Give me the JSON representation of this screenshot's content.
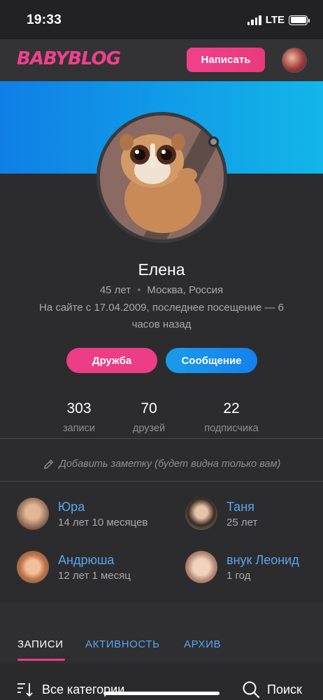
{
  "status_bar": {
    "time": "19:33",
    "network": "LTE"
  },
  "header": {
    "logo": "BABYBLOG",
    "write_button": "Написать"
  },
  "profile": {
    "name": "Елена",
    "age": "45 лет",
    "location": "Москва, Россия",
    "since": "На сайте с 17.04.2009, последнее посещение — 6 часов назад",
    "friend_button": "Дружба",
    "message_button": "Сообщение"
  },
  "stats": [
    {
      "value": "303",
      "label": "записи"
    },
    {
      "value": "70",
      "label": "друзей"
    },
    {
      "value": "22",
      "label": "подписчика"
    }
  ],
  "note": "Добавить заметку (будет видна только вам)",
  "family": [
    {
      "name": "Юра",
      "age": "14 лет 10 месяцев"
    },
    {
      "name": "Таня",
      "age": "25 лет"
    },
    {
      "name": "Андрюша",
      "age": "12 лет 1 месяц"
    },
    {
      "name": "внук Леонид",
      "age": "1 год"
    }
  ],
  "tabs": [
    "ЗАПИСИ",
    "АКТИВНОСТЬ",
    "АРХИВ"
  ],
  "filter": {
    "categories": "Все категории",
    "search": "Поиск"
  },
  "colors": {
    "brand_pink": "#ec3d85",
    "link_blue": "#5aa6f0",
    "banner_blue": "#12b6e8"
  }
}
